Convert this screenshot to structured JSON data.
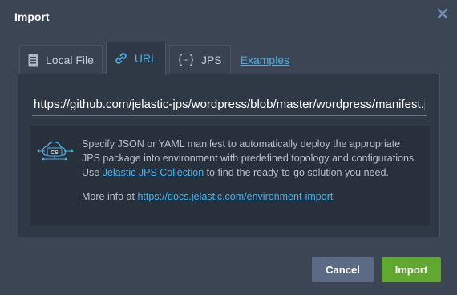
{
  "dialog": {
    "title": "Import"
  },
  "tabs": [
    {
      "label": "Local File",
      "icon": "file-icon",
      "active": false
    },
    {
      "label": "URL",
      "icon": "link-icon",
      "active": true
    },
    {
      "label": "JPS",
      "icon": "braces-icon",
      "active": false
    }
  ],
  "examples_link": "Examples",
  "url_input": {
    "value": "https://github.com/jelastic-jps/wordpress/blob/master/wordpress/manifest.jps"
  },
  "info": {
    "icon": "cs-cloud-icon",
    "line1": "Specify JSON or YAML manifest to automatically deploy the appropriate JPS package into environment with predefined topology and configurations.",
    "use_prefix": "Use ",
    "collection_link": "Jelastic JPS Collection",
    "use_suffix": " to find the ready-to-go solution you need.",
    "more_prefix": "More info at ",
    "docs_link": "https://docs.jelastic.com/environment-import"
  },
  "buttons": {
    "cancel": "Cancel",
    "import": "Import"
  },
  "colors": {
    "accent": "#4ab0e8",
    "import_button": "#61a830",
    "cancel_button": "#5b6b85",
    "background": "#3b4553"
  }
}
